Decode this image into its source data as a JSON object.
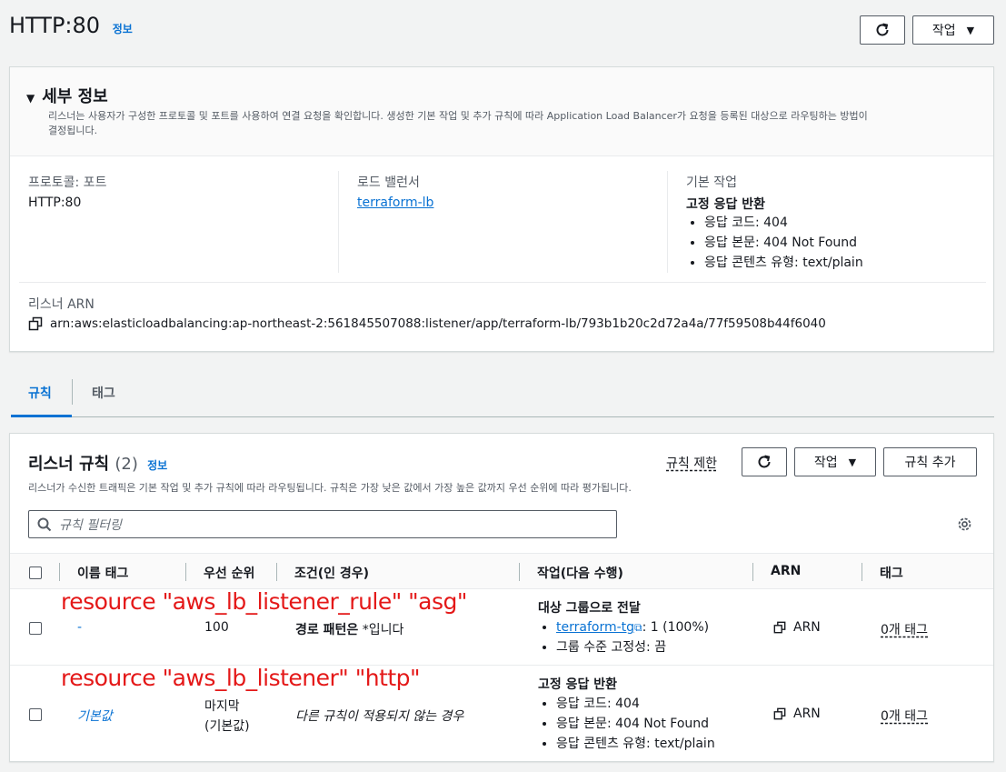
{
  "header": {
    "title": "HTTP:80",
    "info": "정보",
    "actions_label": "작업"
  },
  "details": {
    "title": "세부 정보",
    "description_line1": "리스너는 사용자가 구성한 프로토콜 및 포트를 사용하여 연결 요청을 확인합니다. 생성한 기본 작업 및 추가 규칙에 따라 Application Load Balancer가 요청을 등록된 대상으로 라우팅하는 방법이",
    "description_line2": "결정됩니다.",
    "protocol_label": "프로토콜: 포트",
    "protocol_value": "HTTP:80",
    "lb_label": "로드 밸런서",
    "lb_value": "terraform-lb",
    "default_action_label": "기본 작업",
    "default_action_title": "고정 응답 반환",
    "default_action_items": [
      "응답 코드: 404",
      "응답 본문: 404 Not Found",
      "응답 콘텐츠 유형: text/plain"
    ],
    "arn_label": "리스너 ARN",
    "arn_value": "arn:aws:elasticloadbalancing:ap-northeast-2:561845507088:listener/app/terraform-lb/793b1b20c2d72a4a/77f59508b44f6040"
  },
  "tabs": {
    "rules": "규칙",
    "tags": "태그"
  },
  "rules_panel": {
    "title": "리스너 규칙",
    "count": "(2)",
    "info": "정보",
    "limit_label": "규칙 제한",
    "actions_label": "작업",
    "add_rule_label": "규칙 추가",
    "description": "리스너가 수신한 트래픽은 기본 작업 및 추가 규칙에 따라 라우팅됩니다. 규칙은 가장 낮은 값에서 가장 높은 값까지 우선 순위에 따라 평가됩니다.",
    "filter_placeholder": "규칙 필터링"
  },
  "table": {
    "columns": [
      "이름 태그",
      "우선 순위",
      "조건(인 경우)",
      "작업(다음 수행)",
      "ARN",
      "태그"
    ],
    "rows": [
      {
        "annotation": "resource \"aws_lb_listener_rule\" \"asg\"",
        "name": "-",
        "priority": "100",
        "condition_bold": "경로 패턴은",
        "condition_rest": " *입니다",
        "action_title": "대상 그룹으로 전달",
        "action_tg": "terraform-tg",
        "action_tg_rest": ": 1 (100%)",
        "action_item2": "그룹 수준 고정성: 끔",
        "arn": "ARN",
        "tags": "0개 태그"
      },
      {
        "annotation": "resource \"aws_lb_listener\" \"http\"",
        "name": "기본값",
        "priority_line1": "마지막",
        "priority_line2": "(기본값)",
        "condition": "다른 규칙이 적용되지 않는 경우",
        "action_title": "고정 응답 반환",
        "action_items": [
          "응답 코드: 404",
          "응답 본문: 404 Not Found",
          "응답 콘텐츠 유형: text/plain"
        ],
        "arn": "ARN",
        "tags": "0개 태그"
      }
    ]
  }
}
